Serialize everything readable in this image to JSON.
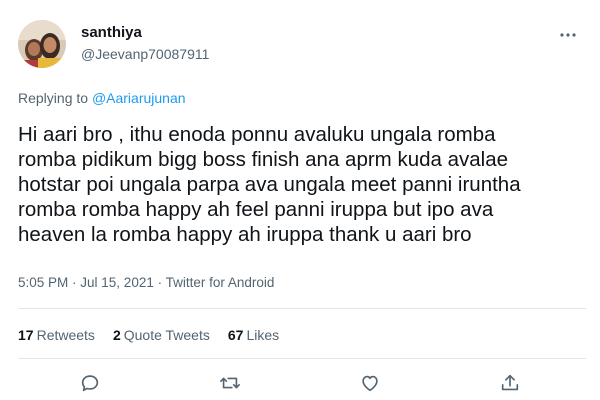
{
  "user": {
    "display_name": "santhiya",
    "handle": "@Jeevanp70087911"
  },
  "reply": {
    "prefix": "Replying to ",
    "mention": "@Aariarujunan"
  },
  "tweet": {
    "lines": [
      "Hi aari bro , ithu enoda ponnu avaluku ungala romba",
      "romba pidikum bigg boss finish ana aprm kuda avalae",
      "hotstar poi ungala parpa ava ungala meet panni iruntha",
      "romba romba happy ah feel panni iruppa but ipo ava",
      "heaven la romba happy ah iruppa thank u aari bro"
    ]
  },
  "meta": {
    "time": "5:05 PM",
    "sep1": " · ",
    "date": "Jul 15, 2021",
    "sep2": " · ",
    "source": "Twitter for Android"
  },
  "stats": {
    "retweets_count": "17",
    "retweets_label": "Retweets",
    "quotes_count": "2",
    "quotes_label": "Quote Tweets",
    "likes_count": "67",
    "likes_label": "Likes"
  },
  "icons": {
    "more": "more-icon",
    "reply": "reply-icon",
    "retweet": "retweet-icon",
    "like": "like-icon",
    "share": "share-icon"
  },
  "colors": {
    "accent": "#1d9bf0",
    "secondary_text": "#536471",
    "primary_text": "#0f1419",
    "divider": "#e1e8ed"
  }
}
